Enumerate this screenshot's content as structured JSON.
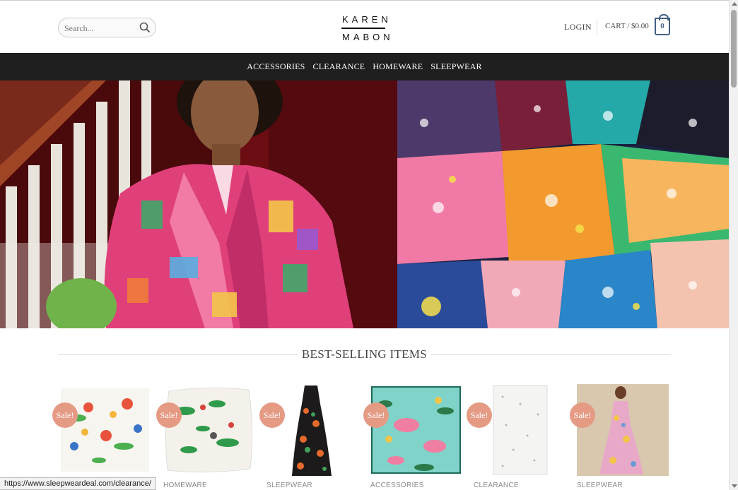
{
  "header": {
    "search_placeholder": "Search...",
    "logo_line1": "KAREN",
    "logo_line2": "MABON",
    "login_label": "LOGIN",
    "cart_label": "CART / $0.00",
    "cart_count": "0"
  },
  "nav": {
    "items": [
      {
        "label": "ACCESSORIES"
      },
      {
        "label": "CLEARANCE"
      },
      {
        "label": "HOMEWARE"
      },
      {
        "label": "SLEEPWEAR"
      }
    ]
  },
  "section": {
    "title": "BEST-SELLING ITEMS"
  },
  "products": [
    {
      "badge": "Sale!",
      "category": ""
    },
    {
      "badge": "Sale!",
      "category": "HOMEWARE"
    },
    {
      "badge": "Sale!",
      "category": "SLEEPWEAR"
    },
    {
      "badge": "Sale!",
      "category": "ACCESSORIES"
    },
    {
      "badge": "Sale!",
      "category": "CLEARANCE"
    },
    {
      "badge": "Sale!",
      "category": "SLEEPWEAR"
    }
  ],
  "status_bar": {
    "url": "https://www.sleepweardeal.com/clearance/"
  },
  "colors": {
    "nav_bg": "#1f1f1f",
    "accent_blue": "#446084",
    "sale_badge": "#e59a84"
  }
}
